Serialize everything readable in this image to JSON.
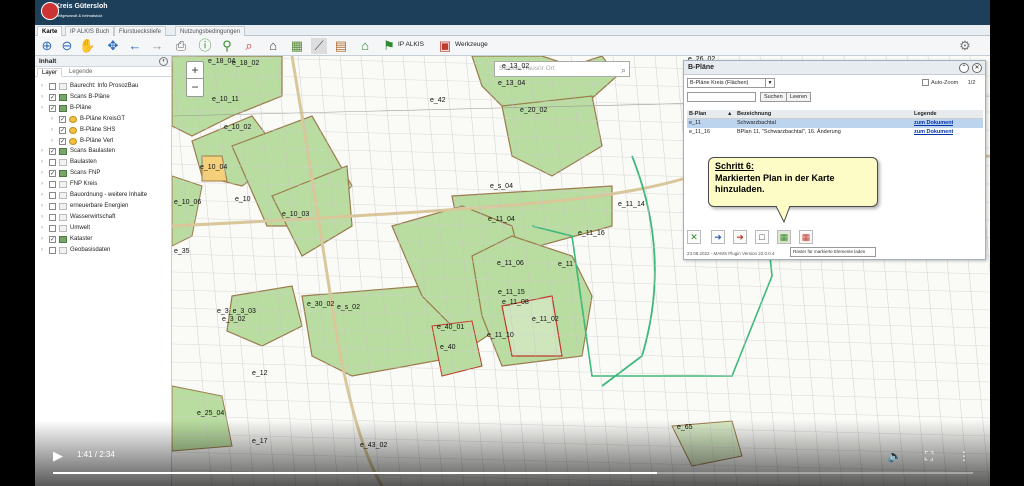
{
  "app": {
    "logo_text": "Kreis Gütersloh",
    "logo_subtext": "weltgewandt & heimatstolz"
  },
  "tabs": [
    "Karte",
    "IP ALKIS Buch",
    "Flurstueckstiefe",
    "Nutzungsbedingungen"
  ],
  "toolbar": {
    "ip_alkis_label": "IP ALKIS",
    "werkzeuge_label": "Werkzeuge"
  },
  "left_panel": {
    "title": "Inhalt",
    "tabs": [
      "Layer",
      "Legende"
    ],
    "layers": [
      {
        "label": "Baurecht: Info ProsozBau",
        "checked": false
      },
      {
        "label": "Scans B-Pläne",
        "checked": true
      },
      {
        "label": "B-Pläne",
        "checked": true
      },
      {
        "label": "B-Pläne KreisGT",
        "checked": true
      },
      {
        "label": "B-Pläne SHS",
        "checked": true
      },
      {
        "label": "B-Pläne Verl",
        "checked": true
      },
      {
        "label": "Scans Baulasten",
        "checked": true
      },
      {
        "label": "Baulasten",
        "checked": false
      },
      {
        "label": "Scans FNP",
        "checked": true
      },
      {
        "label": "FNP Kreis",
        "checked": false
      },
      {
        "label": "Bauordnung - weitere Inhalte",
        "checked": false
      },
      {
        "label": "erneuerbare Energien",
        "checked": false
      },
      {
        "label": "Wasserwirtschaft",
        "checked": false
      },
      {
        "label": "Umwelt",
        "checked": false
      },
      {
        "label": "Kataster",
        "checked": true
      },
      {
        "label": "Geobasisdaten",
        "checked": false
      }
    ]
  },
  "map": {
    "search_placeholder": "Strasse  Hausnr  Ort",
    "labels": [
      "e_18_04",
      "e_18_02",
      "e_10_11",
      "e_10_02",
      "e_10_04",
      "e_10",
      "e_10_03",
      "e_10_06",
      "e_35",
      "e_30_02",
      "e_s_02",
      "e_3_e_3_03",
      "e_3_02",
      "e_12",
      "e_25_04",
      "e_17",
      "e_43_02",
      "e_42",
      "e_13_02",
      "e_13_04",
      "e_20_02",
      "e_s_04",
      "e_11_04",
      "e_11_16",
      "e_11_14",
      "e_11_06",
      "e_11",
      "e_11_15",
      "e_11_08",
      "e_11_02",
      "e_40_01",
      "e_40",
      "e_11_10",
      "e_26_02",
      "e_65"
    ]
  },
  "bplan": {
    "title": "B-Pläne",
    "select_value": "B-Pläne Kreis (Flächen)",
    "auto_zoom_label": "Auto-Zoom",
    "page": "1/2",
    "search_button": "Suchen",
    "clear_button": "Leeren",
    "columns": [
      "B-Plan",
      "Bezeichnung",
      "Legende"
    ],
    "rows": [
      {
        "plan": "e_11",
        "name": "Schwarzbachtal",
        "legend": "zum Dokument",
        "selected": true
      },
      {
        "plan": "e_11_16",
        "name": "BPlan 11, \"Schwarzbachtal\", 16. Änderung",
        "legend": "zum Dokument",
        "selected": false
      }
    ],
    "version": "23.08.2022 - MAMS Plugin Version 22.0.0.4",
    "tooltip": "Raster für markierte Elemente laden"
  },
  "callout": {
    "step": "Schritt 6:",
    "text": "Markierten Plan in der Karte hinzuladen."
  },
  "player": {
    "time": "1:41 / 2:34",
    "progress": 0.656
  }
}
